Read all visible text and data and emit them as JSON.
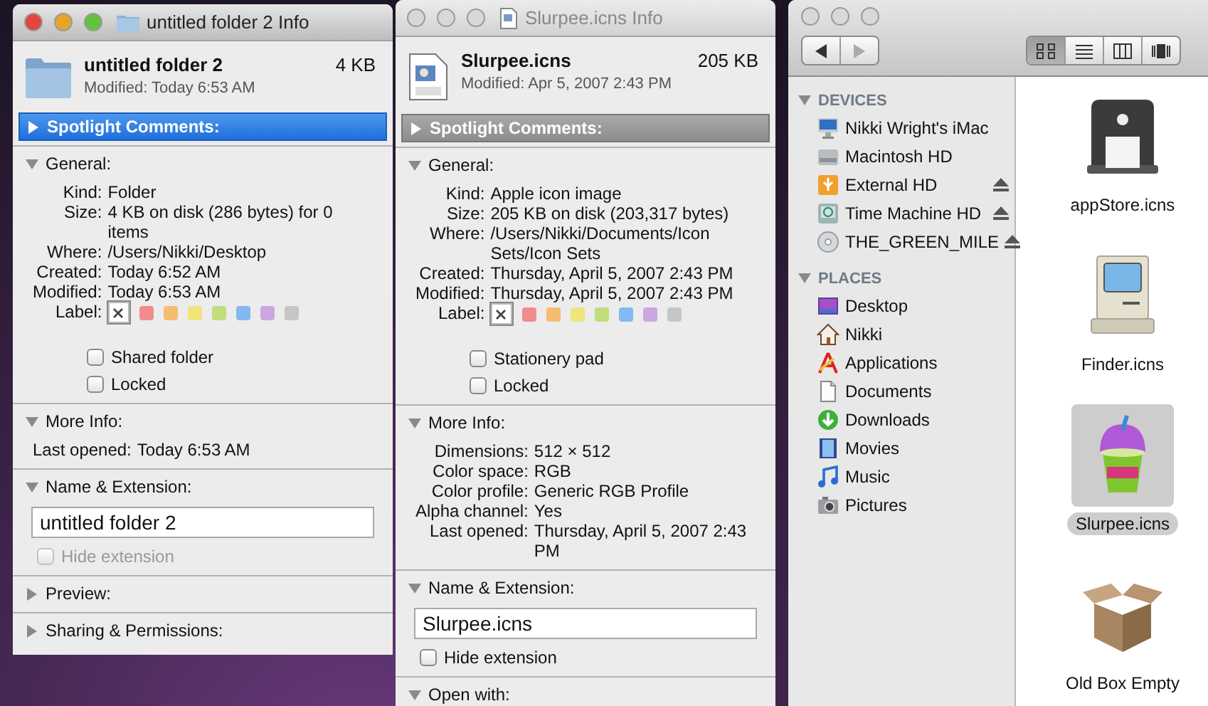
{
  "info_windows": [
    {
      "title": "untitled folder 2 Info",
      "active": true,
      "kind": "folder",
      "name": "untitled folder 2",
      "size": "4 KB",
      "modified": "Modified: Today 6:53 AM",
      "spotlight": {
        "label": "Spotlight Comments:",
        "selected": true,
        "expanded": false
      },
      "sections": [
        {
          "kind": "general",
          "label": "General:",
          "expanded": true,
          "rows": [
            {
              "label": "Kind:",
              "value": "Folder"
            },
            {
              "label": "Size:",
              "value": "4 KB on disk (286 bytes) for 0 items"
            },
            {
              "label": "Where:",
              "value": "/Users/Nikki/Desktop"
            },
            {
              "label": "Created:",
              "value": "Today 6:52 AM"
            },
            {
              "label": "Modified:",
              "value": "Today 6:53 AM"
            }
          ],
          "label_caption": "Label:",
          "label_options": [
            {
              "kind": "none",
              "selected": true
            },
            {
              "kind": "color",
              "color": "#f28b8b",
              "selected": false
            },
            {
              "kind": "color",
              "color": "#f5bd72",
              "selected": false
            },
            {
              "kind": "color",
              "color": "#f0e47c",
              "selected": false
            },
            {
              "kind": "color",
              "color": "#c3dc7c",
              "selected": false
            },
            {
              "kind": "color",
              "color": "#82b9f2",
              "selected": false
            },
            {
              "kind": "color",
              "color": "#caa6e2",
              "selected": false
            },
            {
              "kind": "color",
              "color": "#c6c6c6",
              "selected": false
            }
          ],
          "checkboxes": [
            {
              "label": "Shared folder",
              "checked": false,
              "disabled": false
            },
            {
              "label": "Locked",
              "checked": false,
              "disabled": false
            }
          ]
        },
        {
          "kind": "info",
          "label": "More Info:",
          "expanded": true,
          "rows": [
            {
              "label": "Last opened:",
              "value": "Today 6:53 AM"
            }
          ]
        },
        {
          "kind": "name",
          "label": "Name & Extension:",
          "expanded": true,
          "value": "untitled folder 2",
          "checkboxes": [
            {
              "label": "Hide extension",
              "checked": false,
              "disabled": true
            }
          ]
        },
        {
          "label": "Preview:",
          "expanded": false
        },
        {
          "label": "Sharing & Permissions:",
          "expanded": false
        }
      ]
    },
    {
      "title": "Slurpee.icns Info",
      "active": false,
      "kind": "document",
      "name": "Slurpee.icns",
      "size": "205 KB",
      "modified": "Modified: Apr 5, 2007 2:43 PM",
      "spotlight": {
        "label": "Spotlight Comments:",
        "selected": false,
        "expanded": false
      },
      "sections": [
        {
          "kind": "general",
          "label": "General:",
          "expanded": true,
          "rows": [
            {
              "label": "Kind:",
              "value": "Apple icon image"
            },
            {
              "label": "Size:",
              "value": "205 KB on disk (203,317 bytes)"
            },
            {
              "label": "Where:",
              "value": "/Users/Nikki/Documents/Icon Sets/Icon Sets"
            },
            {
              "label": "Created:",
              "value": "Thursday, April 5, 2007 2:43 PM"
            },
            {
              "label": "Modified:",
              "value": "Thursday, April 5, 2007 2:43 PM"
            }
          ],
          "label_caption": "Label:",
          "label_options": [
            {
              "kind": "none",
              "selected": true
            },
            {
              "kind": "color",
              "color": "#f28b8b",
              "selected": false
            },
            {
              "kind": "color",
              "color": "#f5bd72",
              "selected": false
            },
            {
              "kind": "color",
              "color": "#f0e47c",
              "selected": false
            },
            {
              "kind": "color",
              "color": "#c3dc7c",
              "selected": false
            },
            {
              "kind": "color",
              "color": "#82b9f2",
              "selected": false
            },
            {
              "kind": "color",
              "color": "#caa6e2",
              "selected": false
            },
            {
              "kind": "color",
              "color": "#c6c6c6",
              "selected": false
            }
          ],
          "checkboxes": [
            {
              "label": "Stationery pad",
              "checked": false,
              "disabled": false
            },
            {
              "label": "Locked",
              "checked": false,
              "disabled": false
            }
          ]
        },
        {
          "kind": "info",
          "label": "More Info:",
          "expanded": true,
          "rows": [
            {
              "label": "Dimensions:",
              "value": "512 × 512"
            },
            {
              "label": "Color space:",
              "value": "RGB"
            },
            {
              "label": "Color profile:",
              "value": "Generic RGB Profile"
            },
            {
              "label": "Alpha channel:",
              "value": "Yes"
            },
            {
              "label": "Last opened:",
              "value": "Thursday, April 5, 2007 2:43 PM"
            }
          ]
        },
        {
          "kind": "name",
          "label": "Name & Extension:",
          "expanded": true,
          "value": "Slurpee.icns",
          "checkboxes": [
            {
              "label": "Hide extension",
              "checked": false,
              "disabled": false
            }
          ]
        },
        {
          "label": "Open with:",
          "expanded": true
        }
      ]
    }
  ],
  "finder": {
    "active": false,
    "nav": [
      {
        "kind": "back",
        "disabled": false
      },
      {
        "kind": "forward",
        "disabled": true
      }
    ],
    "view_modes": [
      {
        "kind": "icon",
        "selected": true
      },
      {
        "kind": "list",
        "selected": false
      },
      {
        "kind": "column",
        "selected": false
      },
      {
        "kind": "coverflow",
        "selected": false
      }
    ],
    "sidebar": [
      {
        "heading": "DEVICES",
        "expanded": true,
        "items": [
          {
            "label": "Nikki Wright's iMac",
            "kind": "imac",
            "eject": false
          },
          {
            "label": "Macintosh HD",
            "kind": "hd",
            "eject": false
          },
          {
            "label": "External HD",
            "kind": "external",
            "eject": true
          },
          {
            "label": "Time Machine HD",
            "kind": "timemachine",
            "eject": true
          },
          {
            "label": "THE_GREEN_MILE",
            "kind": "cd",
            "eject": true
          }
        ]
      },
      {
        "heading": "PLACES",
        "expanded": true,
        "items": [
          {
            "label": "Desktop",
            "kind": "desktop",
            "eject": false
          },
          {
            "label": "Nikki",
            "kind": "home",
            "eject": false
          },
          {
            "label": "Applications",
            "kind": "apps",
            "eject": false
          },
          {
            "label": "Documents",
            "kind": "docs",
            "eject": false
          },
          {
            "label": "Downloads",
            "kind": "downloads",
            "eject": false
          },
          {
            "label": "Movies",
            "kind": "movies",
            "eject": false
          },
          {
            "label": "Music",
            "kind": "music",
            "eject": false
          },
          {
            "label": "Pictures",
            "kind": "pictures",
            "eject": false
          }
        ]
      }
    ],
    "files": [
      {
        "name": "appStore.icns",
        "kind": "appstore",
        "selected": false
      },
      {
        "name": "Finder.icns",
        "kind": "finder",
        "selected": false
      },
      {
        "name": "Slurpee.icns",
        "kind": "slurpee",
        "selected": true
      },
      {
        "name": "Old Box Empty",
        "kind": "box",
        "selected": false
      }
    ]
  }
}
